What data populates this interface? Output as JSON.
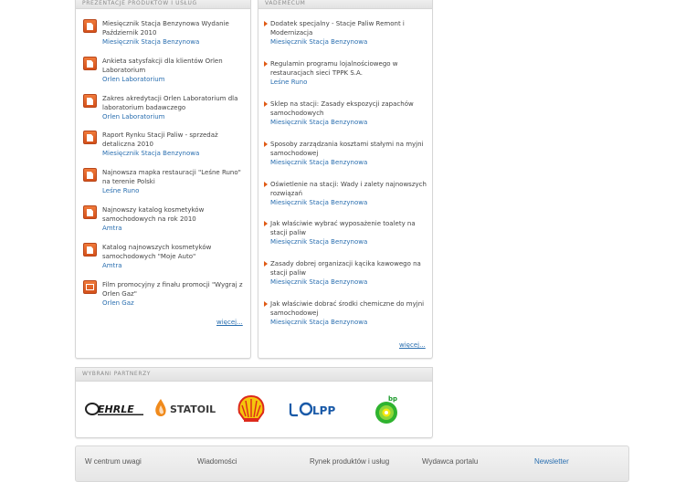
{
  "presentations": {
    "heading": "PREZENTACJE PRODUKTÓW I USŁUG",
    "items": [
      {
        "title": "Miesięcznik Stacja Benzynowa Wydanie Październik 2010",
        "source": "Miesięcznik Stacja Benzynowa",
        "icon": "document-icon"
      },
      {
        "title": "Ankieta satysfakcji dla klientów Orlen Laboratorium",
        "source": "Orlen Laboratorium",
        "icon": "document-icon"
      },
      {
        "title": "Zakres akredytacji Orlen Laboratorium dla laboratorium badawczego",
        "source": "Orlen Laboratorium",
        "icon": "document-icon"
      },
      {
        "title": "Raport Rynku Stacji Paliw - sprzedaż detaliczna 2010",
        "source": "Miesięcznik Stacja Benzynowa",
        "icon": "document-icon"
      },
      {
        "title": "Najnowsza mapka restauracji \"Leśne Runo\" na terenie Polski",
        "source": "Leśne Runo",
        "icon": "document-icon"
      },
      {
        "title": "Najnowszy katalog kosmetyków samochodowych na rok 2010",
        "source": "Amtra",
        "icon": "document-icon"
      },
      {
        "title": "Katalog najnowszych kosmetyków samochodowych \"Moje Auto\"",
        "source": "Amtra",
        "icon": "document-icon"
      },
      {
        "title": "Film promocyjny z finału promocji \"Wygraj z Orlen Gaz\"",
        "source": "Orlen Gaz",
        "icon": "film-icon"
      }
    ],
    "more": "więcej..."
  },
  "vademecum": {
    "heading": "VADEMECUM",
    "items": [
      {
        "title": "Dodatek specjalny - Stacje Paliw Remont i Modernizacja",
        "source": "Miesięcznik Stacja Benzynowa"
      },
      {
        "title": "Regulamin programu lojalnościowego w restauracjach sieci TPPK S.A.",
        "source": "Leśne Runo"
      },
      {
        "title": "Sklep na stacji: Zasady ekspozycji zapachów samochodowych",
        "source": "Miesięcznik Stacja Benzynowa"
      },
      {
        "title": "Sposoby zarządzania kosztami stałymi na myjni samochodowej",
        "source": "Miesięcznik Stacja Benzynowa"
      },
      {
        "title": "Oświetlenie na stacji: Wady i zalety najnowszych rozwiązań",
        "source": "Miesięcznik Stacja Benzynowa"
      },
      {
        "title": "Jak właściwie wybrać wyposażenie toalety na stacji paliw",
        "source": "Miesięcznik Stacja Benzynowa"
      },
      {
        "title": "Zasady dobrej organizacji kącika kawowego na stacji paliw",
        "source": "Miesięcznik Stacja Benzynowa"
      },
      {
        "title": "Jak właściwie dobrać środki chemiczne do myjni samochodowej",
        "source": "Miesięcznik Stacja Benzynowa"
      }
    ],
    "more": "więcej..."
  },
  "partners": {
    "heading": "WYBRANI PARTNERZY",
    "logos": [
      {
        "name": "EHRLE",
        "icon": "ehrle-logo"
      },
      {
        "name": "STATOIL",
        "icon": "statoil-logo"
      },
      {
        "name": "Shell",
        "icon": "shell-logo"
      },
      {
        "name": "OLPP",
        "icon": "olpp-logo"
      },
      {
        "name": "bp",
        "icon": "bp-logo"
      }
    ]
  },
  "footer": {
    "links": [
      "W centrum uwagi",
      "Wiadomości",
      "Rynek produktów i usług",
      "Wydawca portalu",
      "Newsletter"
    ]
  },
  "colors": {
    "link": "#2a6fb0",
    "accent_orange": "#e05a14",
    "panel_border": "#d6d6d6"
  }
}
